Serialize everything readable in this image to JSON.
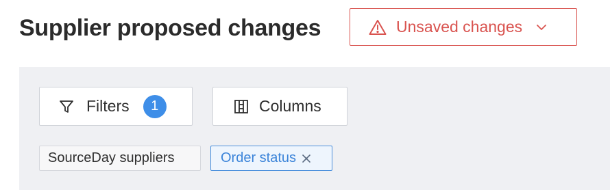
{
  "header": {
    "title": "Supplier proposed changes",
    "unsaved_label": "Unsaved changes",
    "unsaved_icon": "warning-icon",
    "dropdown_icon": "chevron-down-icon"
  },
  "toolbar": {
    "filters_label": "Filters",
    "filters_icon": "filter-icon",
    "filters_count": "1",
    "columns_label": "Columns",
    "columns_icon": "columns-icon"
  },
  "chips": [
    {
      "label": "SourceDay suppliers",
      "active": false
    },
    {
      "label": "Order status",
      "active": true,
      "remove_icon": "close-icon"
    }
  ],
  "colors": {
    "warning": "#d9534f",
    "accent": "#3e8ee8",
    "panel_bg": "#eff0f3"
  }
}
